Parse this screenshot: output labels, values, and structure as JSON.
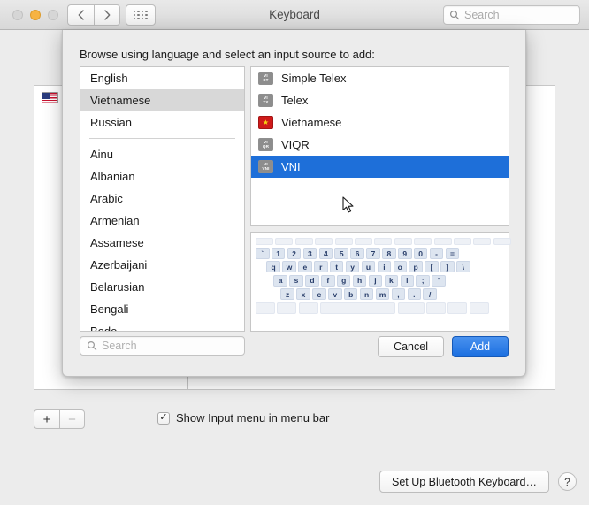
{
  "window": {
    "title": "Keyboard",
    "toolbar_search_placeholder": "Search",
    "nav_back": "‹",
    "nav_forward": "›",
    "grid_icon": "grid-icon"
  },
  "background": {
    "input_source_row_label": "U.S.",
    "add_button": "+",
    "remove_button": "−",
    "checkbox_mark": "✓",
    "show_input_menu_label": "Show Input menu in menu bar",
    "bluetooth_button": "Set Up Bluetooth Keyboard…",
    "help_button": "?"
  },
  "sheet": {
    "heading": "Browse using language and select an input source to add:",
    "search_placeholder": "Search",
    "cancel_label": "Cancel",
    "add_label": "Add",
    "languages": [
      {
        "label": "English",
        "selected": false
      },
      {
        "label": "Vietnamese",
        "selected": true
      },
      {
        "label": "Russian",
        "selected": false
      },
      {
        "separator": true
      },
      {
        "label": "Ainu",
        "selected": false
      },
      {
        "label": "Albanian",
        "selected": false
      },
      {
        "label": "Arabic",
        "selected": false
      },
      {
        "label": "Armenian",
        "selected": false
      },
      {
        "label": "Assamese",
        "selected": false
      },
      {
        "label": "Azerbaijani",
        "selected": false
      },
      {
        "label": "Belarusian",
        "selected": false
      },
      {
        "label": "Bengali",
        "selected": false
      },
      {
        "label": "Bodo",
        "selected": false
      }
    ],
    "input_sources": [
      {
        "label": "Simple Telex",
        "icon": "badge-vi-st",
        "icon_top": "VI",
        "icon_bottom": "ST",
        "selected": false
      },
      {
        "label": "Telex",
        "icon": "badge-vi-tx",
        "icon_top": "VI",
        "icon_bottom": "TX",
        "selected": false
      },
      {
        "label": "Vietnamese",
        "icon": "flag-vietnam",
        "icon_top": "",
        "icon_bottom": "",
        "selected": false
      },
      {
        "label": "VIQR",
        "icon": "badge-vi-qr",
        "icon_top": "VI",
        "icon_bottom": "QR",
        "selected": false
      },
      {
        "label": "VNI",
        "icon": "badge-vi-vni",
        "icon_top": "VI",
        "icon_bottom": "VNI",
        "selected": true
      }
    ],
    "keyboard_preview": {
      "rows": [
        [
          "",
          "",
          "",
          "",
          "",
          "",
          "",
          "",
          "",
          "",
          "",
          "",
          ""
        ],
        [
          "`",
          "1",
          "2",
          "3",
          "4",
          "5",
          "6",
          "7",
          "8",
          "9",
          "0",
          "-",
          "="
        ],
        [
          "q",
          "w",
          "e",
          "r",
          "t",
          "y",
          "u",
          "i",
          "o",
          "p",
          "[",
          "]",
          "\\"
        ],
        [
          "a",
          "s",
          "d",
          "f",
          "g",
          "h",
          "j",
          "k",
          "l",
          ";",
          "'"
        ],
        [
          "z",
          "x",
          "c",
          "v",
          "b",
          "n",
          "m",
          ",",
          ".",
          "/"
        ]
      ]
    }
  },
  "colors": {
    "selection_blue": "#1e6fd9",
    "primary_button": "#1b6fe0",
    "inactive_selection": "#d8d8d8",
    "flag_red": "#cf1a1a",
    "flag_star": "#f5d312",
    "key_fill": "#dde5f0",
    "key_text": "#2a3f6b"
  }
}
